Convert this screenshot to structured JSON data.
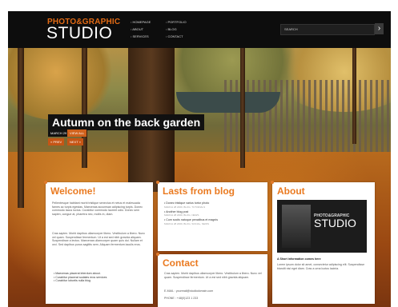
{
  "logo": {
    "top": "PHOTO&GRAPHIC",
    "main": "STUDIO"
  },
  "nav": {
    "col1": [
      "HOMEPAGE",
      "ABOUT",
      "SERVICES"
    ],
    "col2": [
      "PORTFOLIO",
      "BLOG",
      "CONTACT"
    ]
  },
  "search": {
    "label": "SEARCH",
    "button": "›"
  },
  "hero": {
    "caption": "Autumn on the back garden",
    "date": "MARCH 29 2009",
    "view_all": "VIEW ALL",
    "prev": "« PREV",
    "next": "NEXT »"
  },
  "welcome": {
    "title": "Welcome!",
    "p1": "Pellentesque habitant morbi tristique senectus et netus et malesuada fames ac turpis egestas. Maecenas accumsan adipiscing turpis. Donec commodo lacus luctus. Curabitur commodo laoreet odio. Donec sem sapien, congue at, pharetra nec, mollis in, diam.",
    "p2": "Cras sapien. Morbi dapibus ullamcorper libero. Vestibulum a libero. Nunc vel quam. Suspendisse fermentum. Ut a est sed nibh gravida aliquam. Suspendisse a lectus. Maecenas ullamcorper quam quis dui. Nullam et orci. Sed dapibus purus sagittis sem. Aliquam fermentum iaculis eros.",
    "bullets": [
      "Maecenas placerat interdum about.",
      "Curabitur placerat sodales eros services",
      "Curabitur lobortis nulla blog"
    ]
  },
  "blog": {
    "title": "Lasts from blog",
    "items": [
      {
        "title": "Donec tristique varius tortor photo",
        "meta": "MARCH 28 2009, BLOG, TUTORIALS"
      },
      {
        "title": "Another blog post",
        "meta": "MARCH 28 2009, BLOG, NEWS"
      },
      {
        "title": "Cum sociis natoque penatibus et magnis",
        "meta": "MARCH 28 2009, BLOG, SOCIAL, NEWS"
      }
    ]
  },
  "contact": {
    "title": "Contact",
    "text": "Cras sapien. Morbi dapibus ullamcorper libero. Vestibulum a libero. Nunc vel quam. Suspendisse fermentum. Ut a est sed nibh gravida aliquam.",
    "email": "E-MAIL : yourmail@studiodomain.com",
    "phone": "PHONE : +48(0)123 1 233"
  },
  "about": {
    "title": "About",
    "logo_top": "PHOTO&GRAPHIC",
    "logo_main": "STUDIO",
    "heading": "A Short information comes here",
    "text": "Lorem ipsum dolor sit amet, consectetur adipiscing elit. Suspendisse blandit nisi eget diam. Cras a urna luctus lacinia."
  },
  "colors": {
    "accent": "#ea7a20",
    "header_bg": "#0d0d0d"
  }
}
